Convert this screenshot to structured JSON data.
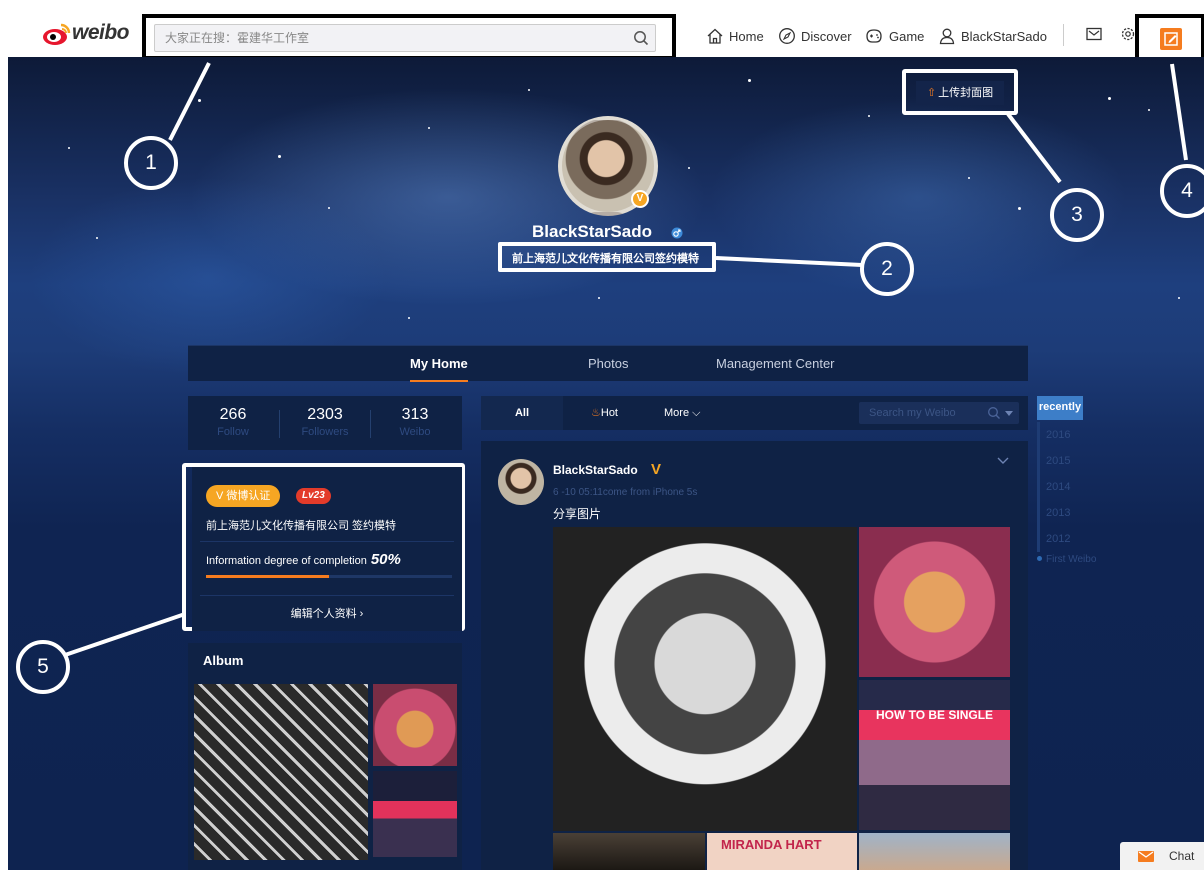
{
  "topbar": {
    "logo_text": "weibo",
    "search_placeholder": "大家正在搜：霍建华工作室",
    "nav": [
      {
        "label": "Home",
        "icon": "home-icon"
      },
      {
        "label": "Discover",
        "icon": "compass-icon"
      },
      {
        "label": "Game",
        "icon": "gamepad-icon"
      },
      {
        "label": "BlackStarSado",
        "icon": "user-icon"
      }
    ],
    "icons": [
      "mail-icon",
      "gear-icon",
      "compose-icon"
    ]
  },
  "cover": {
    "upload_label": "上传封面图"
  },
  "profile": {
    "username": "BlackStarSado",
    "verified_mark": "V",
    "bio": "前上海范儿文化传播有限公司签约模特"
  },
  "callouts": [
    "1",
    "2",
    "3",
    "4",
    "5"
  ],
  "tabs": [
    {
      "label": "My Home",
      "active": true
    },
    {
      "label": "Photos",
      "active": false
    },
    {
      "label": "Management Center",
      "active": false
    }
  ],
  "stats": [
    {
      "value": "266",
      "label": "Follow"
    },
    {
      "value": "2303",
      "label": "Followers"
    },
    {
      "value": "313",
      "label": "Weibo"
    }
  ],
  "info_card": {
    "verified_badge": "V 微博认证",
    "level_badge": "Lv23",
    "description": "前上海范儿文化传播有限公司 签约模特",
    "completion_label": "Information degree of completion",
    "completion_value": "50%",
    "completion_fraction": 0.5,
    "edit_label": "编辑个人资料 ›"
  },
  "album": {
    "title": "Album"
  },
  "feed": {
    "tabs": [
      {
        "label": "All",
        "active": true
      },
      {
        "label": "Hot",
        "icon": "flame-icon"
      },
      {
        "label": "More ⌵"
      }
    ],
    "search_placeholder": "Search my Weibo"
  },
  "post": {
    "author": "BlackStarSado",
    "verified_mark": "V",
    "meta": "6 -10 05:11come from iPhone 5s",
    "text": "分享图片",
    "images": [
      {
        "alt": "selfie-pixelated"
      },
      {
        "alt": "cat"
      },
      {
        "caption": "HOW TO BE SINGLE"
      },
      {
        "caption": "MIRANDA HART"
      },
      {
        "alt": "interior"
      },
      {
        "alt": "sky"
      }
    ]
  },
  "timeline": {
    "current": "recently",
    "years": [
      "2016",
      "2015",
      "2014",
      "2013",
      "2012"
    ],
    "first": "First Weibo"
  },
  "chat": {
    "label": "Chat"
  },
  "colors": {
    "accent": "#f57c1f",
    "verified": "#f6a623",
    "level": "#e33b2a",
    "panel": "#0f2245",
    "hero_top": "#0d1a38",
    "hero_mid": "#1e3f7e"
  }
}
